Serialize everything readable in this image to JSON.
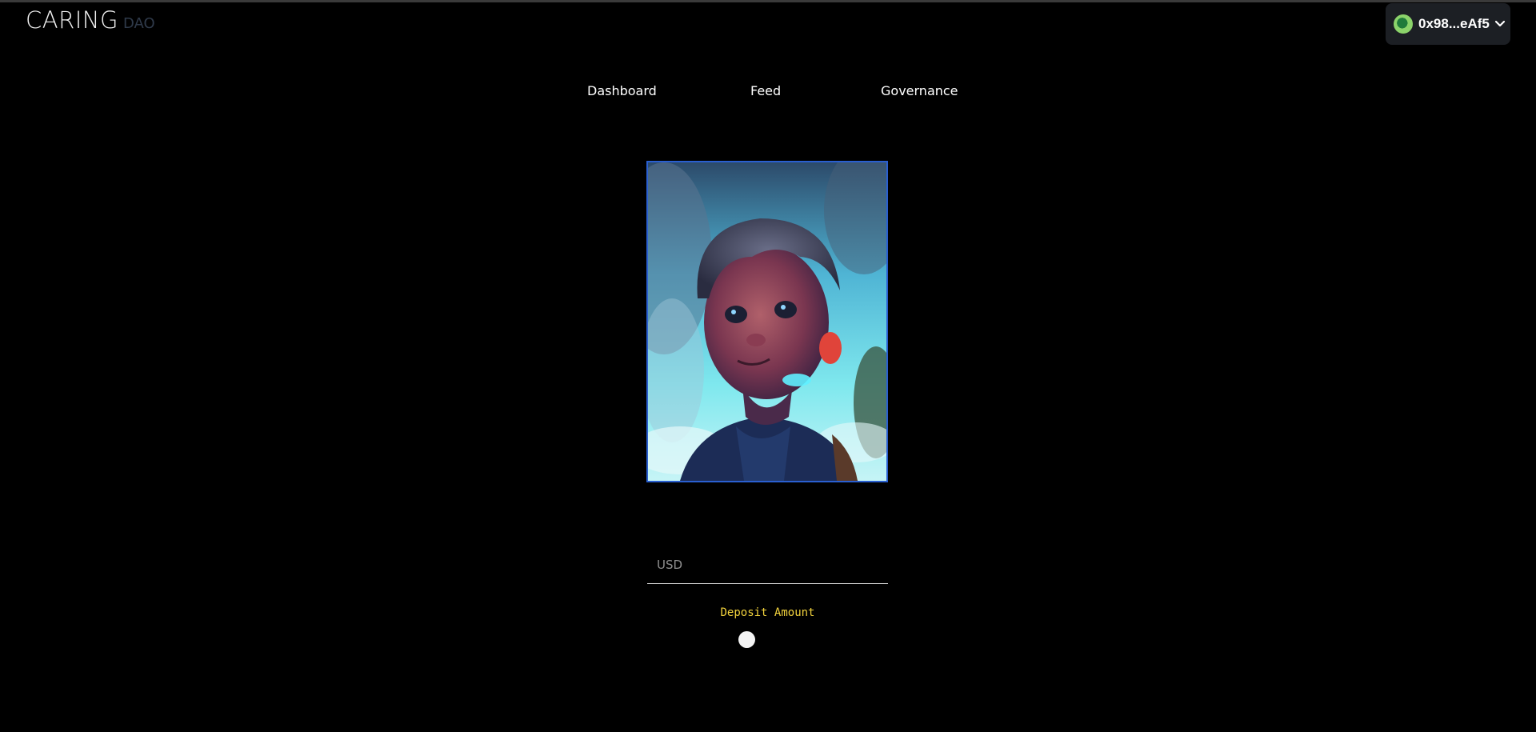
{
  "header": {
    "logo_main": "CARING",
    "logo_sub": "DAO"
  },
  "wallet": {
    "address": "0x98...eAf5",
    "avatar_icon": "green-wallet-avatar-icon",
    "chevron_icon": "chevron-down-icon"
  },
  "nav": {
    "items": [
      {
        "label": "Dashboard"
      },
      {
        "label": "Feed"
      },
      {
        "label": "Governance"
      }
    ]
  },
  "deposit": {
    "currency_placeholder": "USD",
    "label": "Deposit Amount"
  },
  "colors": {
    "background": "#000000",
    "frame_border": "#2a5fd0",
    "deposit_label": "#f2d23c",
    "wallet_bg": "#1c1f24"
  }
}
